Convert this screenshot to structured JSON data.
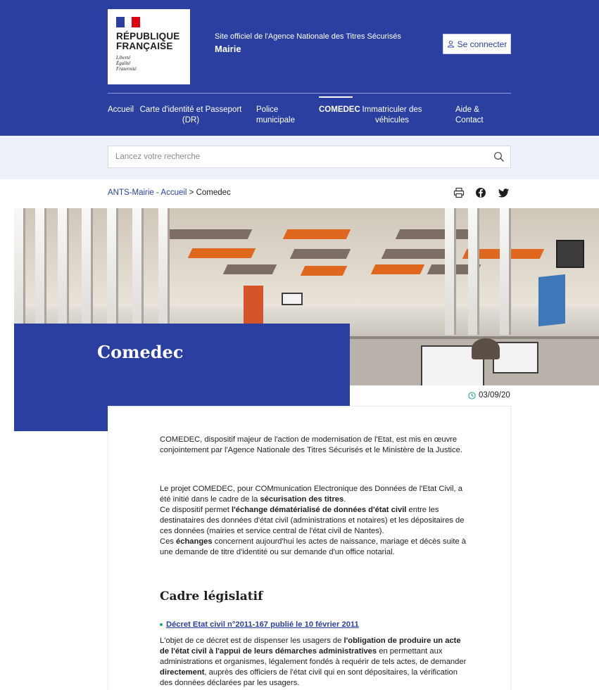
{
  "header": {
    "logo_title": "RÉPUBLIQUE\nFRANÇAISE",
    "logo_motto": "Liberté\nÉgalité\nFraternité",
    "site_subtitle": "Site officiel de l'Agence Nationale des Titres Sécurisés",
    "site_name": "Mairie",
    "login_label": "Se connecter",
    "nav": [
      {
        "label": "Accueil"
      },
      {
        "label": "Carte d'identité et Passeport (DR)"
      },
      {
        "label": "Police municipale"
      },
      {
        "label": "COMEDEC"
      },
      {
        "label": "Immatriculer des véhicules"
      },
      {
        "label": "Aide & Contact"
      }
    ]
  },
  "search": {
    "placeholder": "Lancez votre recherche"
  },
  "breadcrumb": {
    "home": "ANTS-Mairie - Accueil",
    "separator": ">",
    "current": "Comedec"
  },
  "share": {
    "icons": [
      "print-icon",
      "facebook-icon",
      "twitter-icon"
    ]
  },
  "page": {
    "title": "Comedec",
    "date": "03/09/20"
  },
  "content": {
    "p1": "COMEDEC, dispositif majeur de l'action de modernisation de l'Etat, est mis en œuvre conjointement par l'Agence Nationale des Titres Sécurisés et le Ministère de la Justice.",
    "p2_a": "Le projet COMEDEC, pour COMmunication Electronique des Données de l'Etat Civil, a été initié dans le cadre de la ",
    "p2_b": "sécurisation des titres",
    "p2_c": ".",
    "p3_a": "Ce dispositif permet ",
    "p3_b": "l'échange dématérialisé de données d'état civil",
    "p3_c": " entre les destinataires des données d'état civil (administrations et notaires) et les dépositaires de ces données (mairies et service central de l'état civil de Nantes).",
    "p4_a": "Ces ",
    "p4_b": "échanges",
    "p4_c": " concernent aujourd'hui les actes de naissance, mariage et décès suite à une demande de titre d'identité ou sur demande d'un office notarial.",
    "section_title": "Cadre législatif",
    "link_label": "Décret Etat civil n°2011-167 publié le 10 février 2011",
    "p5_a": "L'objet de ce décret est de dispenser les usagers de ",
    "p5_b": "l'obligation de produire un acte de l'état civil à l'appui de leurs démarches administratives",
    "p5_c": " en permettant aux administrations et organismes, légalement fondés à requérir de tels actes, de demander ",
    "p5_d": "directement",
    "p5_e": ", auprès des officiers de l'état civil qui en sont dépositaires, la vérification des données déclarées par les usagers."
  },
  "colors": {
    "brand": "#2a3fa0",
    "accent": "#19a68e",
    "search_band": "#eef1fa"
  }
}
